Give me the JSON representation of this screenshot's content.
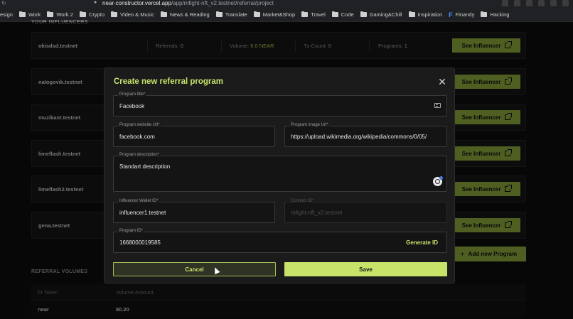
{
  "browser": {
    "url_host": "near-constructor.vercel.app",
    "url_path": "/app/mfight-nft_v2.testnet/referral/project",
    "bookmarks": [
      {
        "label": "esign"
      },
      {
        "label": "Work"
      },
      {
        "label": "Work 2"
      },
      {
        "label": "Crypto"
      },
      {
        "label": "Video & Music"
      },
      {
        "label": "News & Reading"
      },
      {
        "label": "Translate"
      },
      {
        "label": "Market&Shop"
      },
      {
        "label": "Travel"
      },
      {
        "label": "Code"
      },
      {
        "label": "Gaming&Chill"
      },
      {
        "label": "Inspiration"
      },
      {
        "label": "Finandy"
      },
      {
        "label": "Hacking"
      }
    ]
  },
  "page": {
    "influencers_title": "YOUR INFLUENCERS",
    "first_row": {
      "name": "okisdsd.testnet",
      "referrals_label": "Referrals:",
      "referrals_value": "0",
      "volume_label": "Volume:",
      "volume_value": "0.0 NEAR",
      "tx_label": "Tx Count:",
      "tx_value": "0",
      "programs_label": "Programs:",
      "programs_value": "1"
    },
    "influencers": [
      {
        "name": "okisdsd.testnet"
      },
      {
        "name": "nalogovik.testnet"
      },
      {
        "name": "muzikant.testnet"
      },
      {
        "name": "limeflash.testnet"
      },
      {
        "name": "limeflash2.testnet"
      },
      {
        "name": "gena.testnet"
      }
    ],
    "see_influencer_label": "See Influencer",
    "add_program_label": "Add new Program",
    "volumes_title": "REFERRAL VOLUMES",
    "volumes_headers": [
      "Ft Token",
      "Volume Amount"
    ],
    "volumes_rows": [
      {
        "token": "near",
        "amount": "80.20"
      }
    ]
  },
  "modal": {
    "title": "Create new referral program",
    "program_title": {
      "label": "Program title*",
      "value": "Facebook"
    },
    "website_url": {
      "label": "Program website Url*",
      "value": "facebook.com"
    },
    "image_url": {
      "label": "Program image Url*",
      "value": "https://upload.wikimedia.org/wikipedia/commons/0/05/"
    },
    "description": {
      "label": "Program description*",
      "value": "Standart description"
    },
    "wallet_id": {
      "label": "Influencer Wallet ID*",
      "value": "influencer1.testnet"
    },
    "contract_id": {
      "label": "Contract ID*",
      "value": "mfight-nft_v2.testnet"
    },
    "program_id": {
      "label": "Program ID*",
      "value": "1668000019585"
    },
    "generate_id_label": "Generate ID",
    "cancel_label": "Cancel",
    "save_label": "Save"
  }
}
